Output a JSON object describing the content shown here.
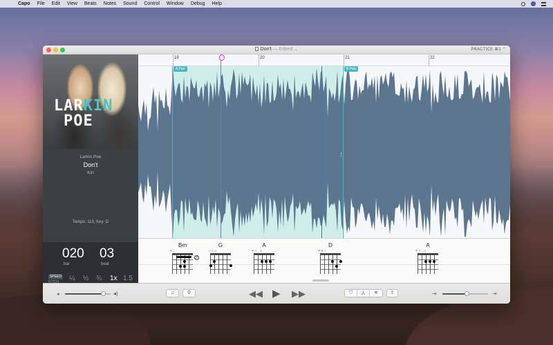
{
  "menubar": {
    "app": "Capo",
    "items": [
      "File",
      "Edit",
      "View",
      "Beats",
      "Notes",
      "Sound",
      "Control",
      "Window",
      "Debug",
      "Help"
    ]
  },
  "window": {
    "title": "Don't",
    "edited": "— Edited ⌄",
    "mode": "PRACTICE ⌘1 ⌃"
  },
  "album": {
    "art_line1_a": "LAR",
    "art_line1_b": "KIN",
    "art_line2": "POE"
  },
  "song": {
    "artist": "Larkin Poe",
    "title": "Don't",
    "album": "Kin",
    "tempo": "Tempo: 113, Key: D"
  },
  "counter": {
    "bar": "020",
    "bar_label": "bar",
    "beat": "03",
    "beat_label": "beat"
  },
  "speed": {
    "speed_label": "SPEED",
    "pitch_label": "PITCH",
    "rates": [
      "¼",
      "½",
      "¾",
      "1x",
      "1.5"
    ],
    "selected": "1x"
  },
  "ruler": {
    "labels": [
      "19",
      "20",
      "21",
      "22"
    ]
  },
  "parts": [
    {
      "label": "A Part"
    },
    {
      "label": "B Part"
    }
  ],
  "chords": [
    {
      "name": "Bm",
      "strings": "×",
      "fret": "2"
    },
    {
      "name": "G",
      "strings": "   ○○○"
    },
    {
      "name": "A",
      "strings": "×○    ○"
    },
    {
      "name": "D",
      "strings": "××○"
    },
    {
      "name": "A",
      "strings": "×○    ○"
    }
  ],
  "toolbar": {
    "vol_low_icon": "speaker-low-icon",
    "vol_high_icon": "speaker-high-icon",
    "volume_level": 0.85,
    "btn_notes": "♫",
    "btn_marker": "⚲",
    "rewind": "◀◀",
    "play": "▶",
    "forward": "▶▶",
    "tools": [
      "⛉",
      "◬",
      "≋"
    ],
    "share": "⇪",
    "speed_low": "⇥",
    "speed_high": "⇥",
    "speed_level": 0.55
  }
}
